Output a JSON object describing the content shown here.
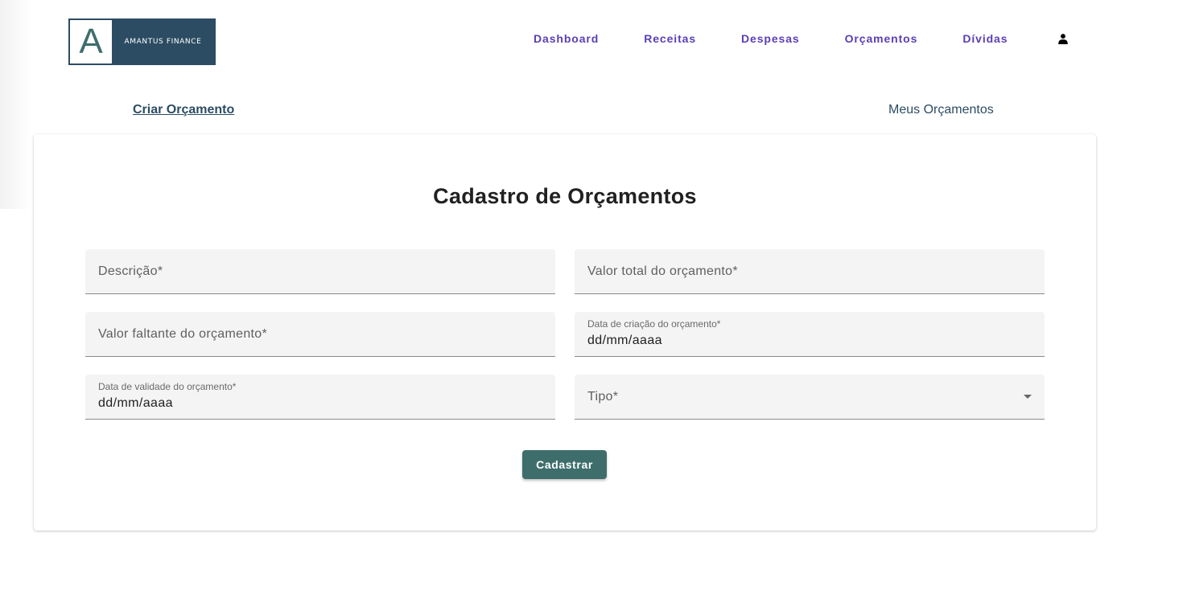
{
  "brand": {
    "mark": "A",
    "name": "AMANTUS FINANCE"
  },
  "nav": {
    "items": [
      {
        "label": "Dashboard"
      },
      {
        "label": "Receitas"
      },
      {
        "label": "Despesas"
      },
      {
        "label": "Orçamentos"
      },
      {
        "label": "Dívidas"
      }
    ],
    "user_icon": "person-icon"
  },
  "tabs": {
    "create": "Criar Orçamento",
    "mine": "Meus Orçamentos"
  },
  "form": {
    "title": "Cadastro de Orçamentos",
    "fields": {
      "descricao": {
        "label": "Descrição*"
      },
      "valor_total": {
        "label": "Valor total do orçamento*"
      },
      "valor_faltante": {
        "label": "Valor faltante do orçamento*"
      },
      "data_criacao": {
        "label": "Data de criação do orçamento*",
        "value": "dd/mm/aaaa"
      },
      "data_validade": {
        "label": "Data de validade do orçamento*",
        "value": "dd/mm/aaaa"
      },
      "tipo": {
        "label": "Tipo*",
        "icon": "dropdown-arrow-icon"
      }
    },
    "submit_label": "Cadastrar"
  },
  "colors": {
    "brand_dark": "#2c4c63",
    "brand_teal": "#3e6e6c",
    "nav_purple": "#5a3fb5"
  }
}
